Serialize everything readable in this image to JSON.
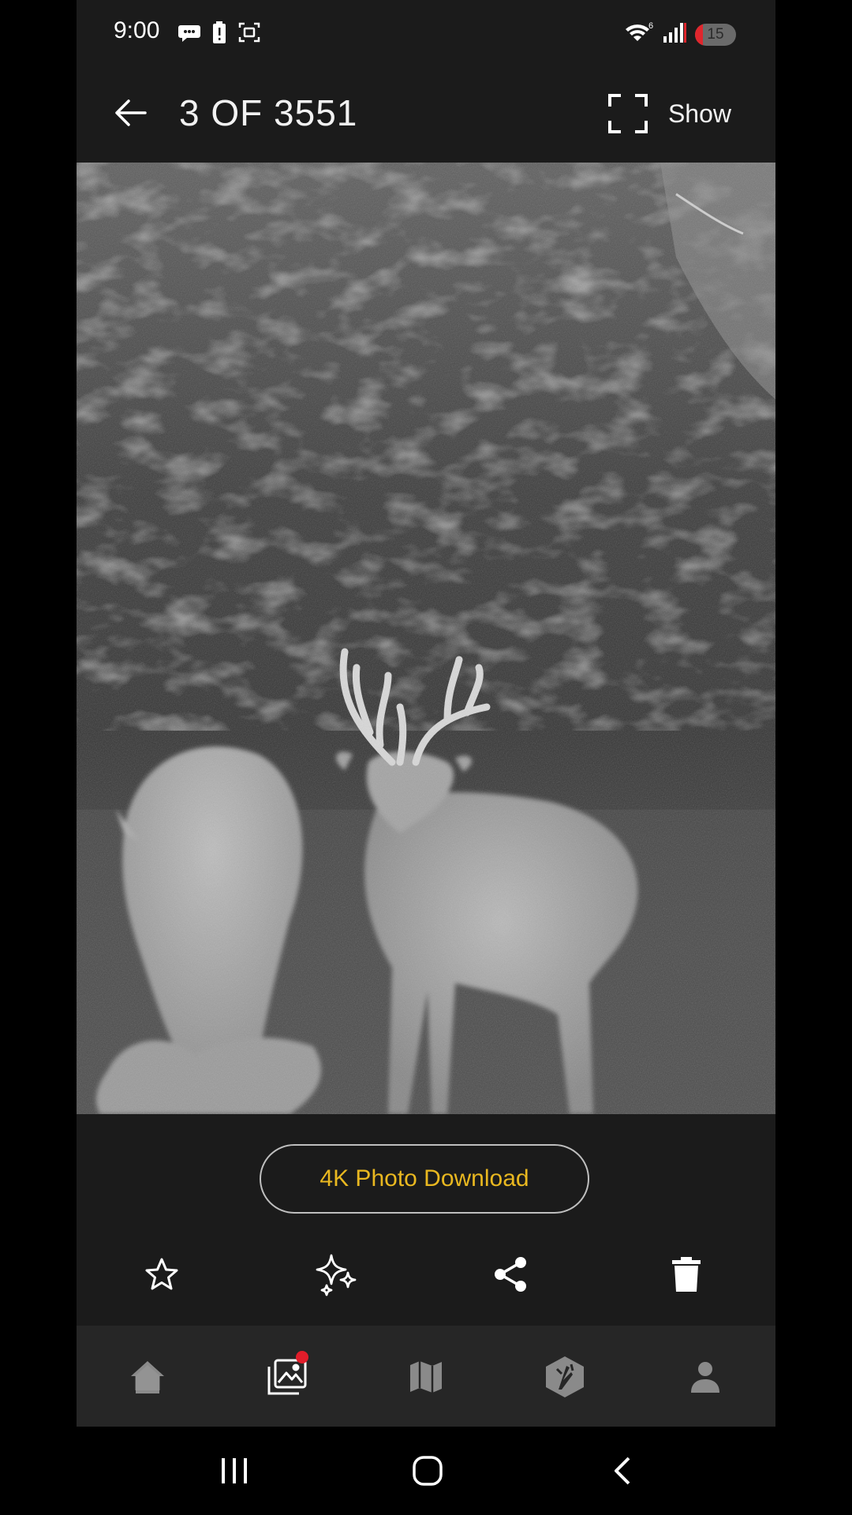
{
  "status_bar": {
    "time": "9:00",
    "left_icons": [
      "chat-icon",
      "battery-alert-icon",
      "screenshot-icon"
    ],
    "right_icons": [
      "wifi-icon",
      "signal-icon"
    ],
    "network_superscript": "6",
    "battery_level": "15",
    "battery_color": "#e0262d"
  },
  "header": {
    "counter": "3 OF 3551",
    "show_label": "Show"
  },
  "photo": {
    "mode": "night-vision grayscale"
  },
  "download": {
    "label": "4K Photo Download",
    "accent": "#e9b820"
  },
  "actions": [
    "star-icon",
    "sparkle-icon",
    "share-icon",
    "trash-icon"
  ],
  "bottom_nav": {
    "items": [
      "home-icon",
      "gallery-icon",
      "map-icon",
      "antler-logo-icon",
      "profile-icon"
    ],
    "gallery_badge_color": "#e11d2a"
  },
  "system_nav": [
    "recents-icon",
    "home-circle-icon",
    "back-chevron-icon"
  ]
}
